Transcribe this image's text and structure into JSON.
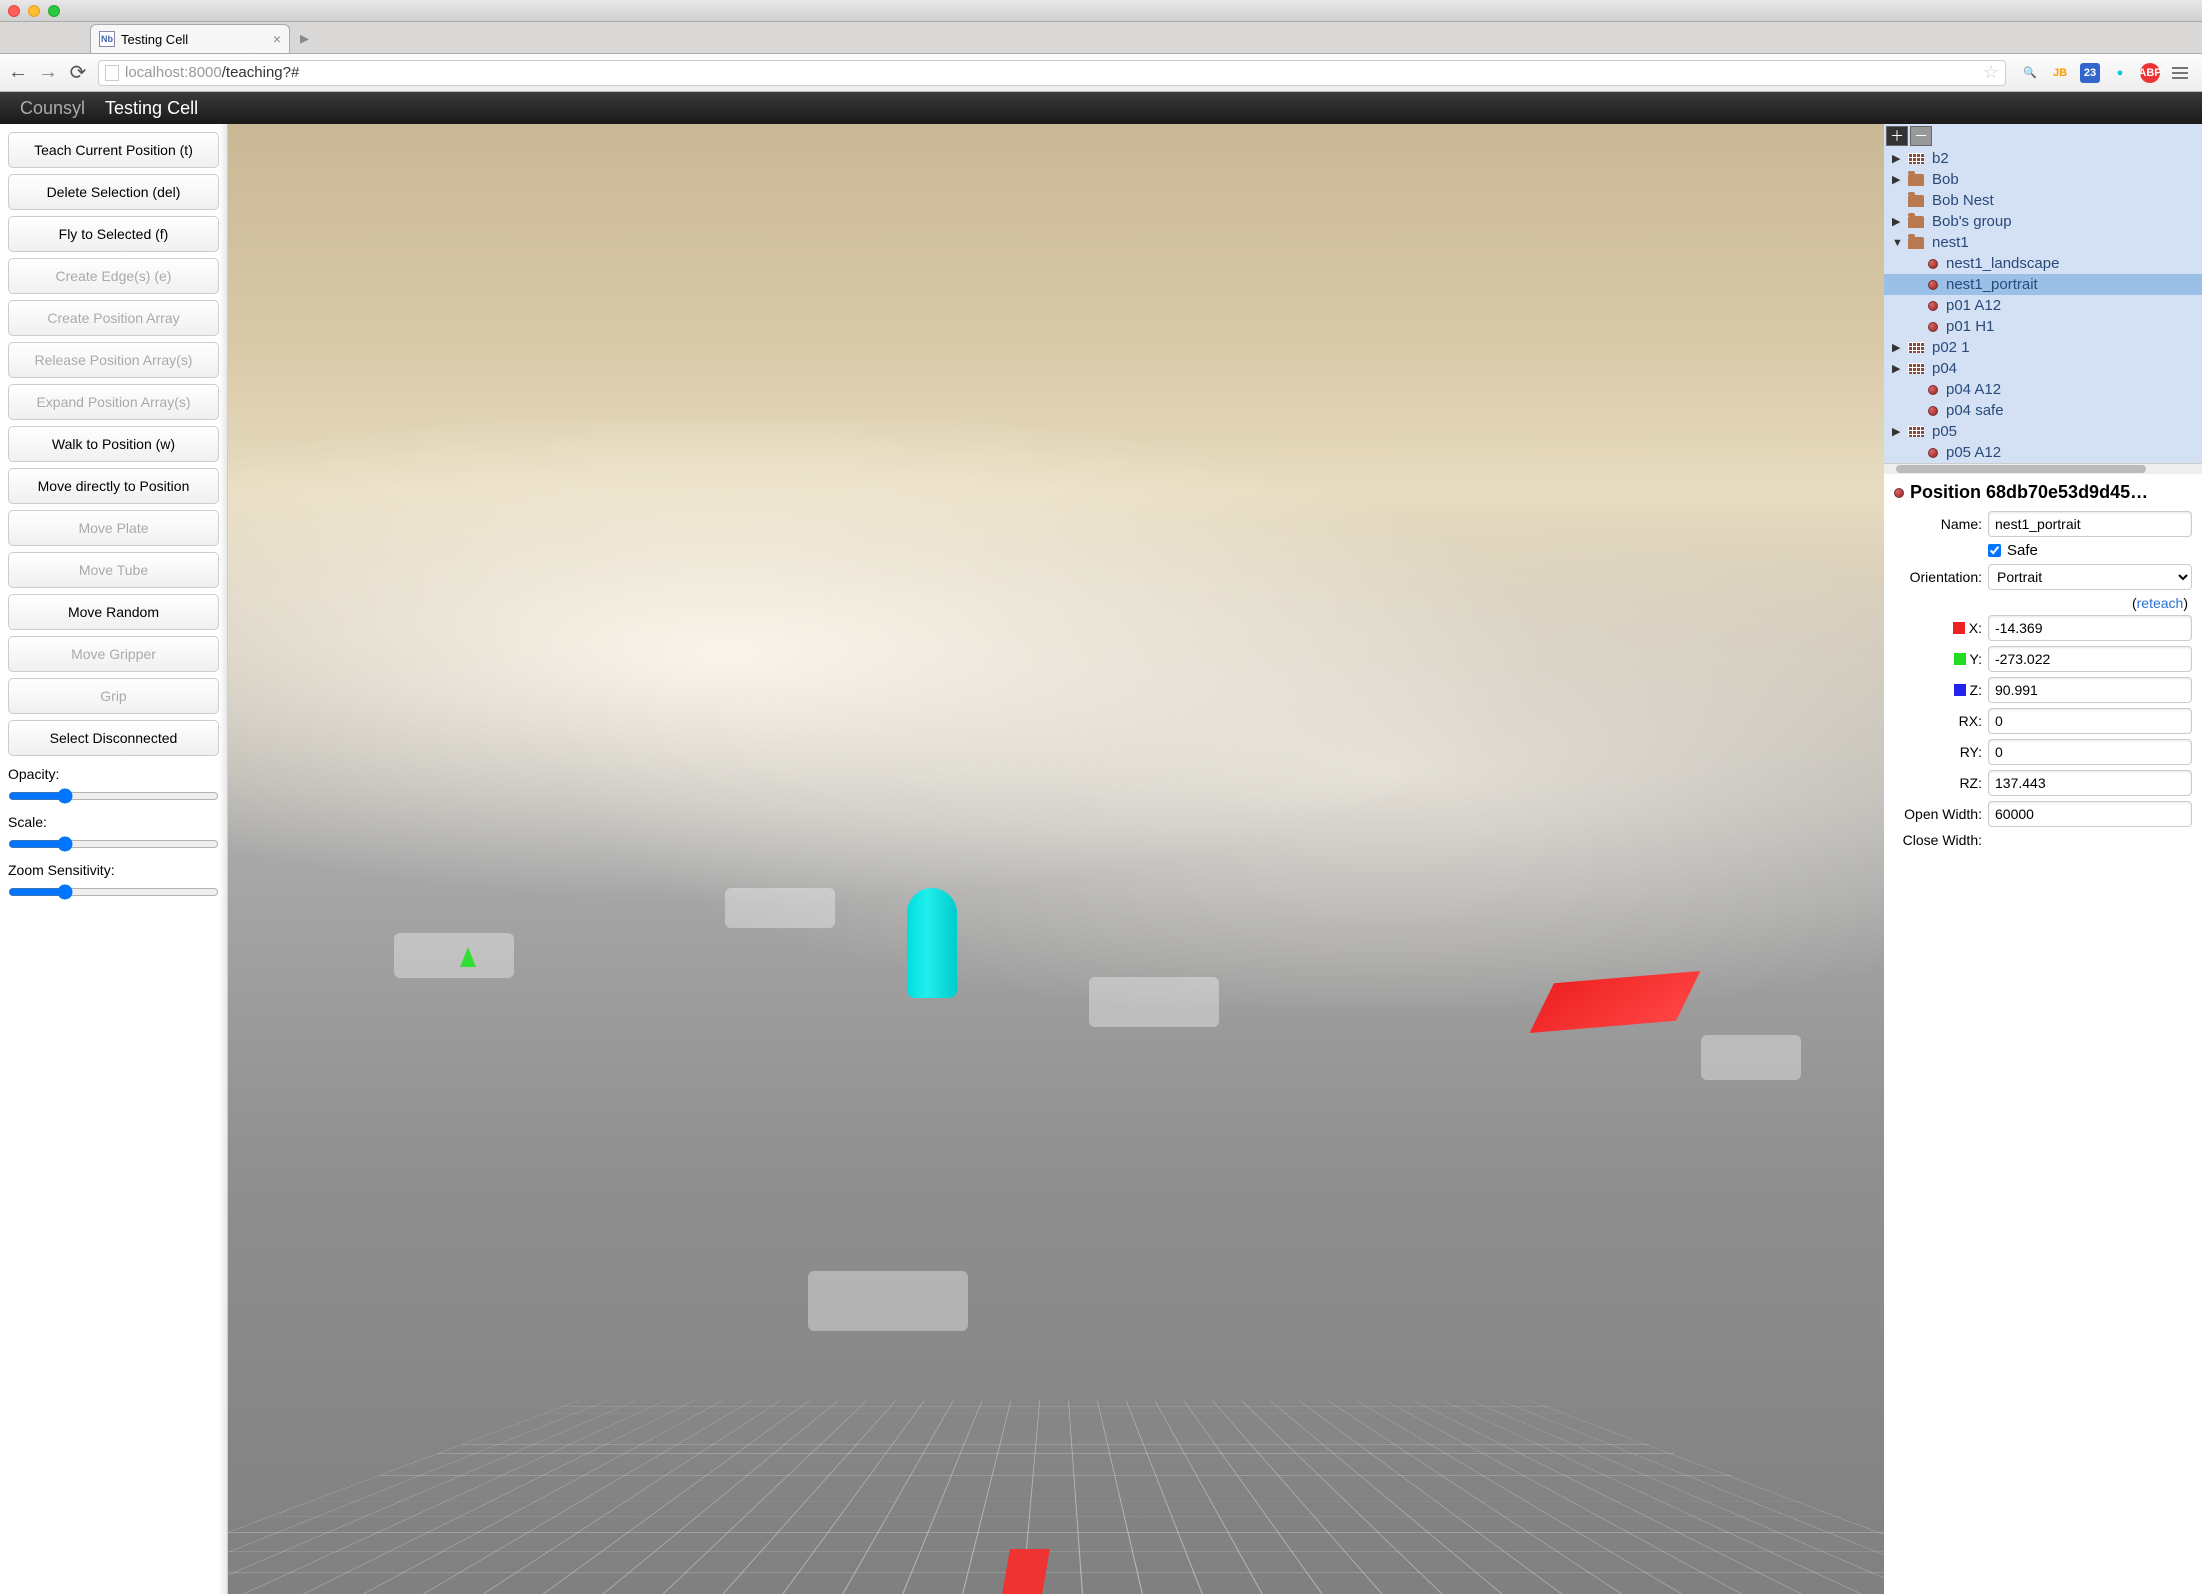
{
  "browser": {
    "tab_title": "Testing Cell",
    "url_host": "localhost",
    "url_port": ":8000",
    "url_path": "/teaching?#"
  },
  "header": {
    "brand": "Counsyl",
    "title": "Testing Cell"
  },
  "left_buttons": [
    {
      "label": "Teach Current Position (t)",
      "enabled": true
    },
    {
      "label": "Delete Selection (del)",
      "enabled": true
    },
    {
      "label": "Fly to Selected (f)",
      "enabled": true
    },
    {
      "label": "Create Edge(s) (e)",
      "enabled": false
    },
    {
      "label": "Create Position Array",
      "enabled": false
    },
    {
      "label": "Release Position Array(s)",
      "enabled": false
    },
    {
      "label": "Expand Position Array(s)",
      "enabled": false
    },
    {
      "label": "Walk to Position (w)",
      "enabled": true
    },
    {
      "label": "Move directly to Position",
      "enabled": true
    },
    {
      "label": "Move Plate",
      "enabled": false
    },
    {
      "label": "Move Tube",
      "enabled": false
    },
    {
      "label": "Move Random",
      "enabled": true
    },
    {
      "label": "Move Gripper",
      "enabled": false
    },
    {
      "label": "Grip",
      "enabled": false
    },
    {
      "label": "Select Disconnected",
      "enabled": true
    }
  ],
  "sliders": {
    "opacity_label": "Opacity:",
    "scale_label": "Scale:",
    "zoom_label": "Zoom Sensitivity:"
  },
  "tree": [
    {
      "indent": 0,
      "arrow": "▶",
      "icon": "grid",
      "label": "b2"
    },
    {
      "indent": 0,
      "arrow": "▶",
      "icon": "folder",
      "label": "Bob"
    },
    {
      "indent": 0,
      "arrow": "",
      "icon": "folder",
      "label": "Bob Nest"
    },
    {
      "indent": 0,
      "arrow": "▶",
      "icon": "folder",
      "label": "Bob's group"
    },
    {
      "indent": 0,
      "arrow": "▼",
      "icon": "folder",
      "label": "nest1"
    },
    {
      "indent": 1,
      "arrow": "",
      "icon": "dot",
      "label": "nest1_landscape"
    },
    {
      "indent": 1,
      "arrow": "",
      "icon": "dot",
      "label": "nest1_portrait",
      "selected": true
    },
    {
      "indent": 1,
      "arrow": "",
      "icon": "dot",
      "label": "p01 A12"
    },
    {
      "indent": 1,
      "arrow": "",
      "icon": "dot",
      "label": "p01 H1"
    },
    {
      "indent": 0,
      "arrow": "▶",
      "icon": "grid",
      "label": "p02 1"
    },
    {
      "indent": 0,
      "arrow": "▶",
      "icon": "grid",
      "label": "p04"
    },
    {
      "indent": 1,
      "arrow": "",
      "icon": "dot",
      "label": "p04 A12"
    },
    {
      "indent": 1,
      "arrow": "",
      "icon": "dot",
      "label": "p04 safe"
    },
    {
      "indent": 0,
      "arrow": "▶",
      "icon": "grid",
      "label": "p05"
    },
    {
      "indent": 1,
      "arrow": "",
      "icon": "dot",
      "label": "p05 A12"
    }
  ],
  "properties": {
    "title": "Position 68db70e53d9d45…",
    "name_label": "Name:",
    "name_value": "nest1_portrait",
    "safe_label": "Safe",
    "safe_checked": true,
    "orientation_label": "Orientation:",
    "orientation_value": "Portrait",
    "reteach_label": "reteach",
    "x_label": "X:",
    "x_value": "-14.369",
    "y_label": "Y:",
    "y_value": "-273.022",
    "z_label": "Z:",
    "z_value": "90.991",
    "rx_label": "RX:",
    "rx_value": "0",
    "ry_label": "RY:",
    "ry_value": "0",
    "rz_label": "RZ:",
    "rz_value": "137.443",
    "open_width_label": "Open Width:",
    "open_width_value": "60000",
    "close_width_label": "Close Width:"
  }
}
